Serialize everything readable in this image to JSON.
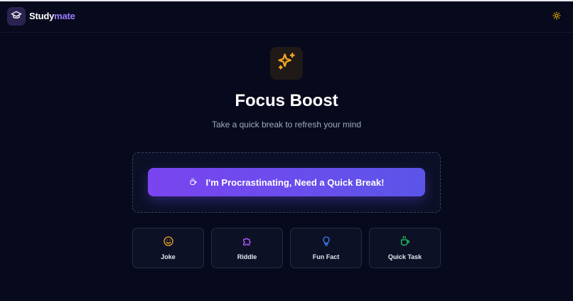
{
  "header": {
    "brand_prefix": "Study",
    "brand_suffix": "mate",
    "logo_icon": "graduation-cap-icon",
    "theme_icon": "sun-icon"
  },
  "hero": {
    "icon": "sparkles-icon",
    "title": "Focus Boost",
    "subtitle": "Take a quick break to refresh your mind"
  },
  "break_panel": {
    "button_label": "I'm Procrastinating, Need a Quick Break!",
    "button_icon": "coffee-cup-icon"
  },
  "options": [
    {
      "label": "Joke",
      "icon": "smile-icon",
      "color": "#f5a524"
    },
    {
      "label": "Riddle",
      "icon": "puzzle-icon",
      "color": "#a855f7"
    },
    {
      "label": "Fun Fact",
      "icon": "lightbulb-icon",
      "color": "#3b82f6"
    },
    {
      "label": "Quick Task",
      "icon": "coffee-icon",
      "color": "#22c55e"
    }
  ],
  "colors": {
    "background": "#070a1c",
    "accent": "#7a44f0",
    "brand_accent": "#9b7bff",
    "sun": "#f5b400"
  }
}
